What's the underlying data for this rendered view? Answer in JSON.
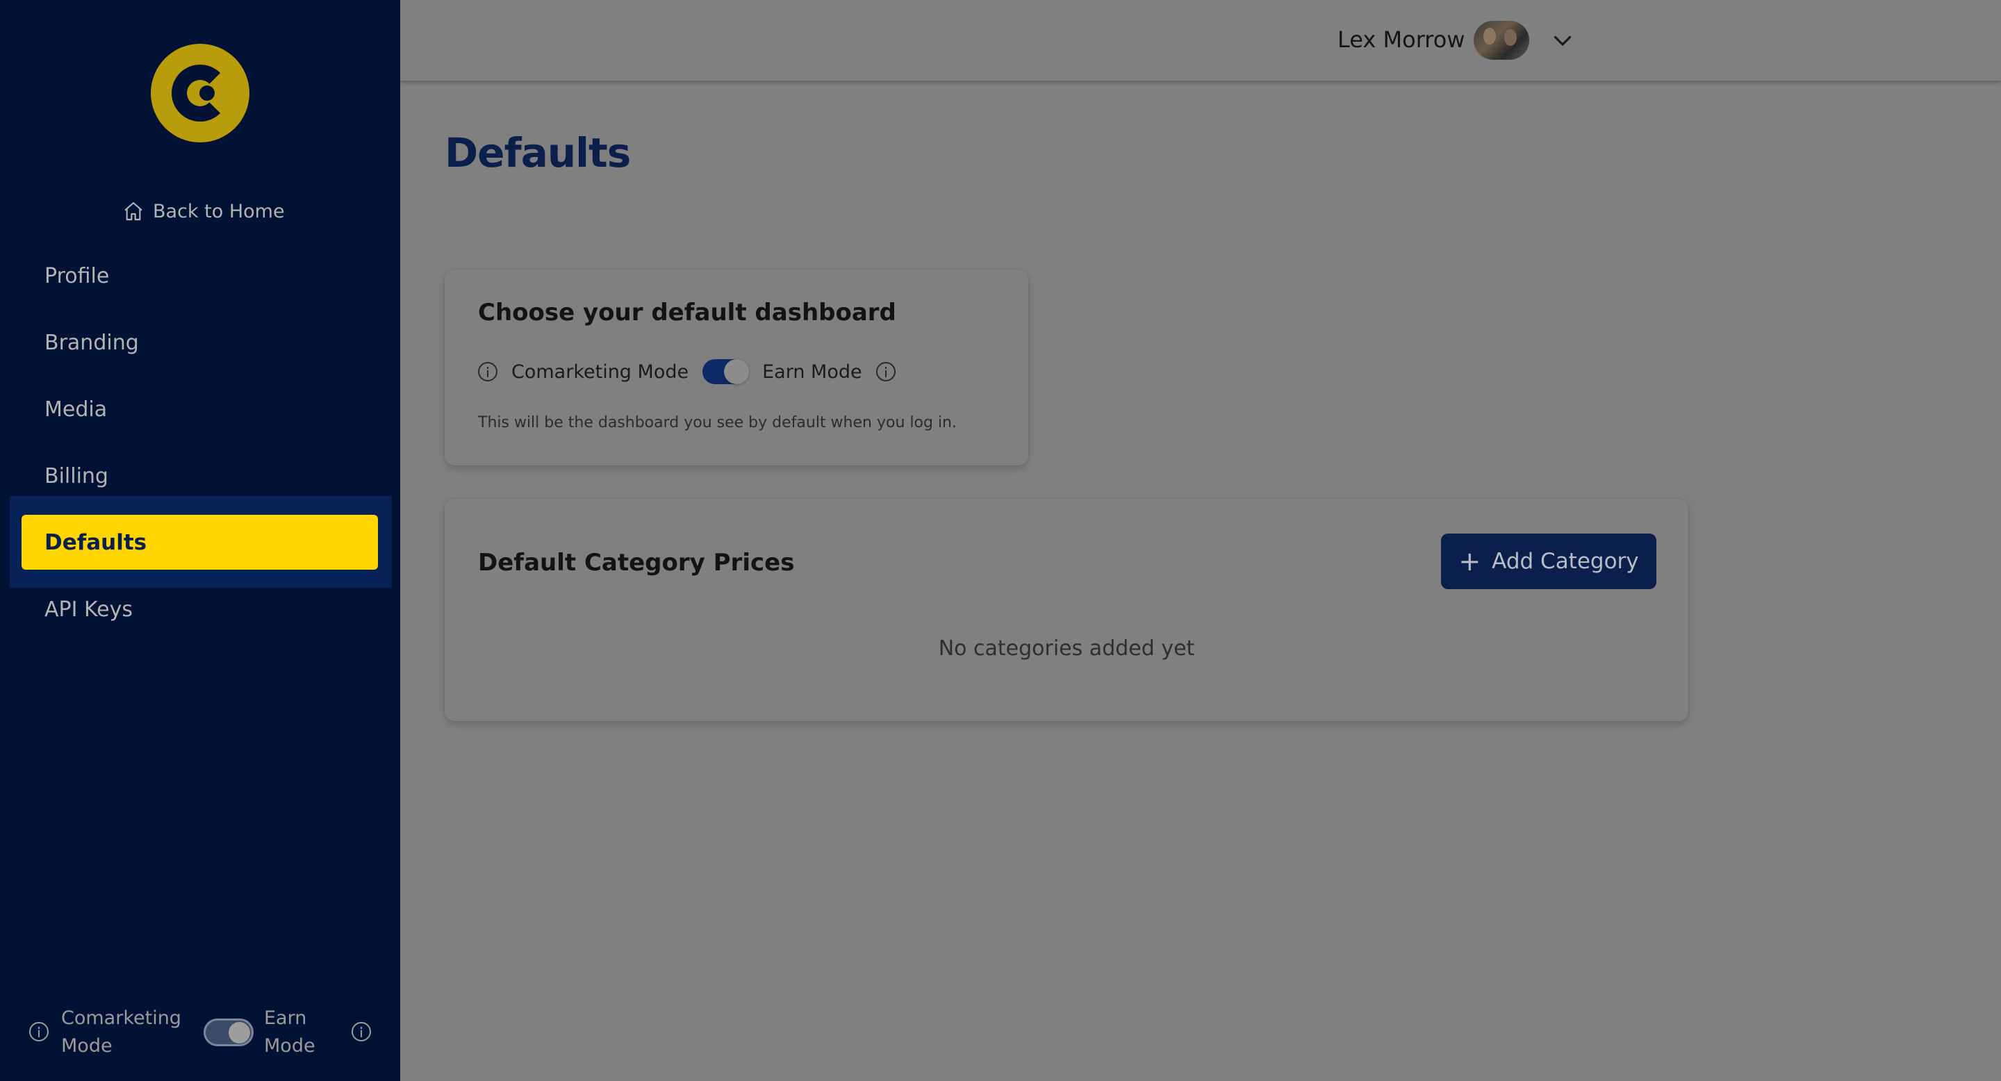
{
  "sidebar": {
    "back_home": "Back to Home",
    "items": [
      {
        "label": "Profile"
      },
      {
        "label": "Branding"
      },
      {
        "label": "Media"
      },
      {
        "label": "Billing"
      },
      {
        "label": "Defaults",
        "active": true
      },
      {
        "label": "API Keys"
      }
    ],
    "mode_toggle": {
      "left_label": "Comarketing Mode",
      "right_label": "Earn Mode",
      "state": "Earn Mode"
    }
  },
  "header": {
    "user_name": "Lex Morrow"
  },
  "page": {
    "title": "Defaults"
  },
  "dashboard_card": {
    "title": "Choose your default dashboard",
    "left_label": "Comarketing Mode",
    "right_label": "Earn Mode",
    "state": "Earn Mode",
    "hint": "This will be the dashboard you see by default when you log in."
  },
  "category_card": {
    "title": "Default Category Prices",
    "add_button": "Add Category",
    "empty_message": "No categories added yet"
  },
  "colors": {
    "sidebar_bg": "#011235",
    "accent_yellow": "#ffd500",
    "brand_navy": "#0b1f4d",
    "overlay_gray": "#808080"
  },
  "icons": [
    "logo",
    "home-icon",
    "info-icon",
    "chevron-down-icon",
    "plus-icon"
  ]
}
